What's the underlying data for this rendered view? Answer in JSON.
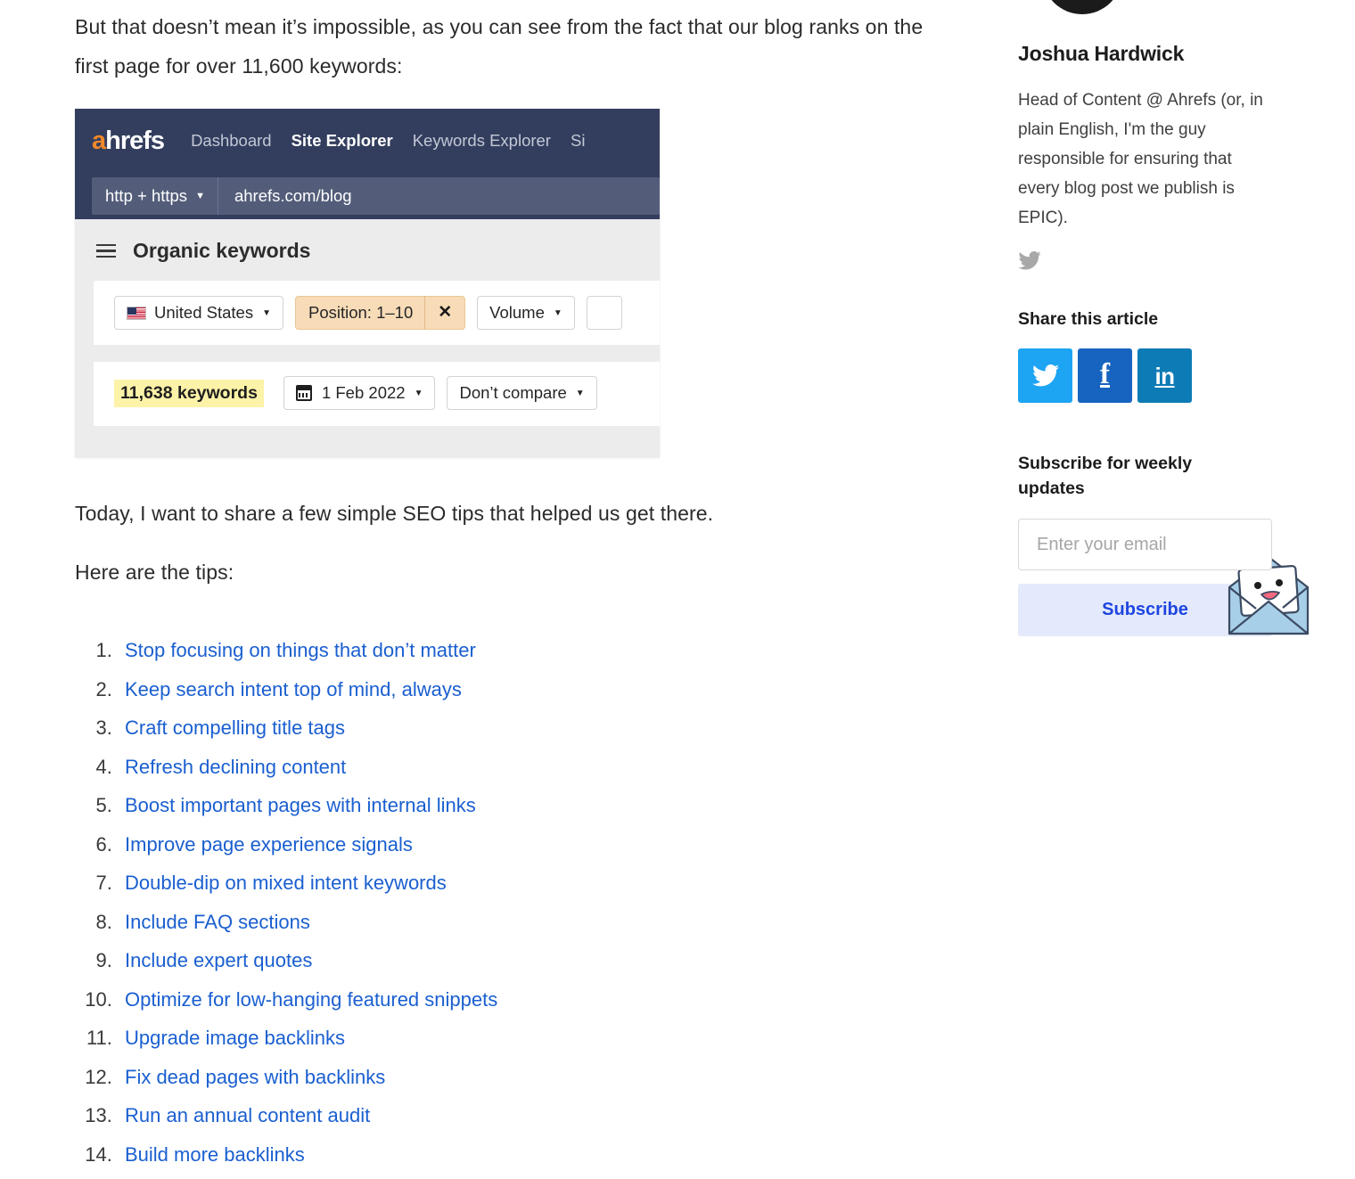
{
  "article": {
    "intro_paragraph": "But that doesn’t mean it’s impossible, as you can see from the fact that our blog ranks on the first page for over 11,600 keywords:",
    "after_image_paragraph": "Today, I want to share a few simple SEO tips that helped us get there.",
    "tips_lead": "Here are the tips:",
    "tips": [
      "Stop focusing on things that don’t matter",
      "Keep search intent top of mind, always",
      "Craft compelling title tags",
      "Refresh declining content",
      "Boost important pages with internal links",
      "Improve page experience signals",
      "Double-dip on mixed intent keywords",
      "Include FAQ sections",
      "Include expert quotes",
      "Optimize for low-hanging featured snippets",
      "Upgrade image backlinks",
      "Fix dead pages with backlinks",
      "Run an annual content audit",
      "Build more backlinks"
    ]
  },
  "ahrefs_screenshot": {
    "logo": "ahrefs",
    "logo_first_letter": "a",
    "logo_rest": "hrefs",
    "nav": [
      {
        "label": "Dashboard",
        "active": false
      },
      {
        "label": "Site Explorer",
        "active": true
      },
      {
        "label": "Keywords Explorer",
        "active": false
      },
      {
        "label": "Si",
        "active": false
      }
    ],
    "protocol_selector": "http + https",
    "target_url": "ahrefs.com/blog",
    "report_title": "Organic keywords",
    "filters": {
      "country": "United States",
      "country_flag_icon": "us-flag-icon",
      "position": "Position: 1–10",
      "position_close_icon": "close-icon",
      "volume": "Volume"
    },
    "keyword_count": "11,638 keywords",
    "date": "1 Feb 2022",
    "date_icon": "calendar-icon",
    "compare": "Don’t compare",
    "colors": {
      "topbar": "#333e5e",
      "logo_accent": "#f0872a",
      "active_filter_bg": "#f8dcb8",
      "count_highlight_bg": "#fdf3a8"
    }
  },
  "sidebar": {
    "avatar_icon": "author-avatar",
    "author_name": "Joshua Hardwick",
    "author_bio": "Head of Content @ Ahrefs (or, in plain English, I'm the guy responsible for ensuring that every blog post we publish is EPIC).",
    "author_twitter_icon": "twitter-icon",
    "share": {
      "heading": "Share this article",
      "buttons": [
        {
          "network": "twitter",
          "icon": "twitter-icon",
          "color": "#1da4f3"
        },
        {
          "network": "facebook",
          "icon": "facebook-icon",
          "glyph": "f",
          "color": "#1764c0"
        },
        {
          "network": "linkedin",
          "icon": "linkedin-icon",
          "glyph": "in",
          "color": "#0d7bb5"
        }
      ]
    },
    "subscribe": {
      "heading": "Subscribe for weekly updates",
      "envelope_icon": "envelope-mascot-icon",
      "email_placeholder": "Enter your email",
      "email_value": "",
      "button_label": "Subscribe",
      "button_bg": "#e4eafb",
      "button_text_color": "#1e45e0"
    }
  }
}
